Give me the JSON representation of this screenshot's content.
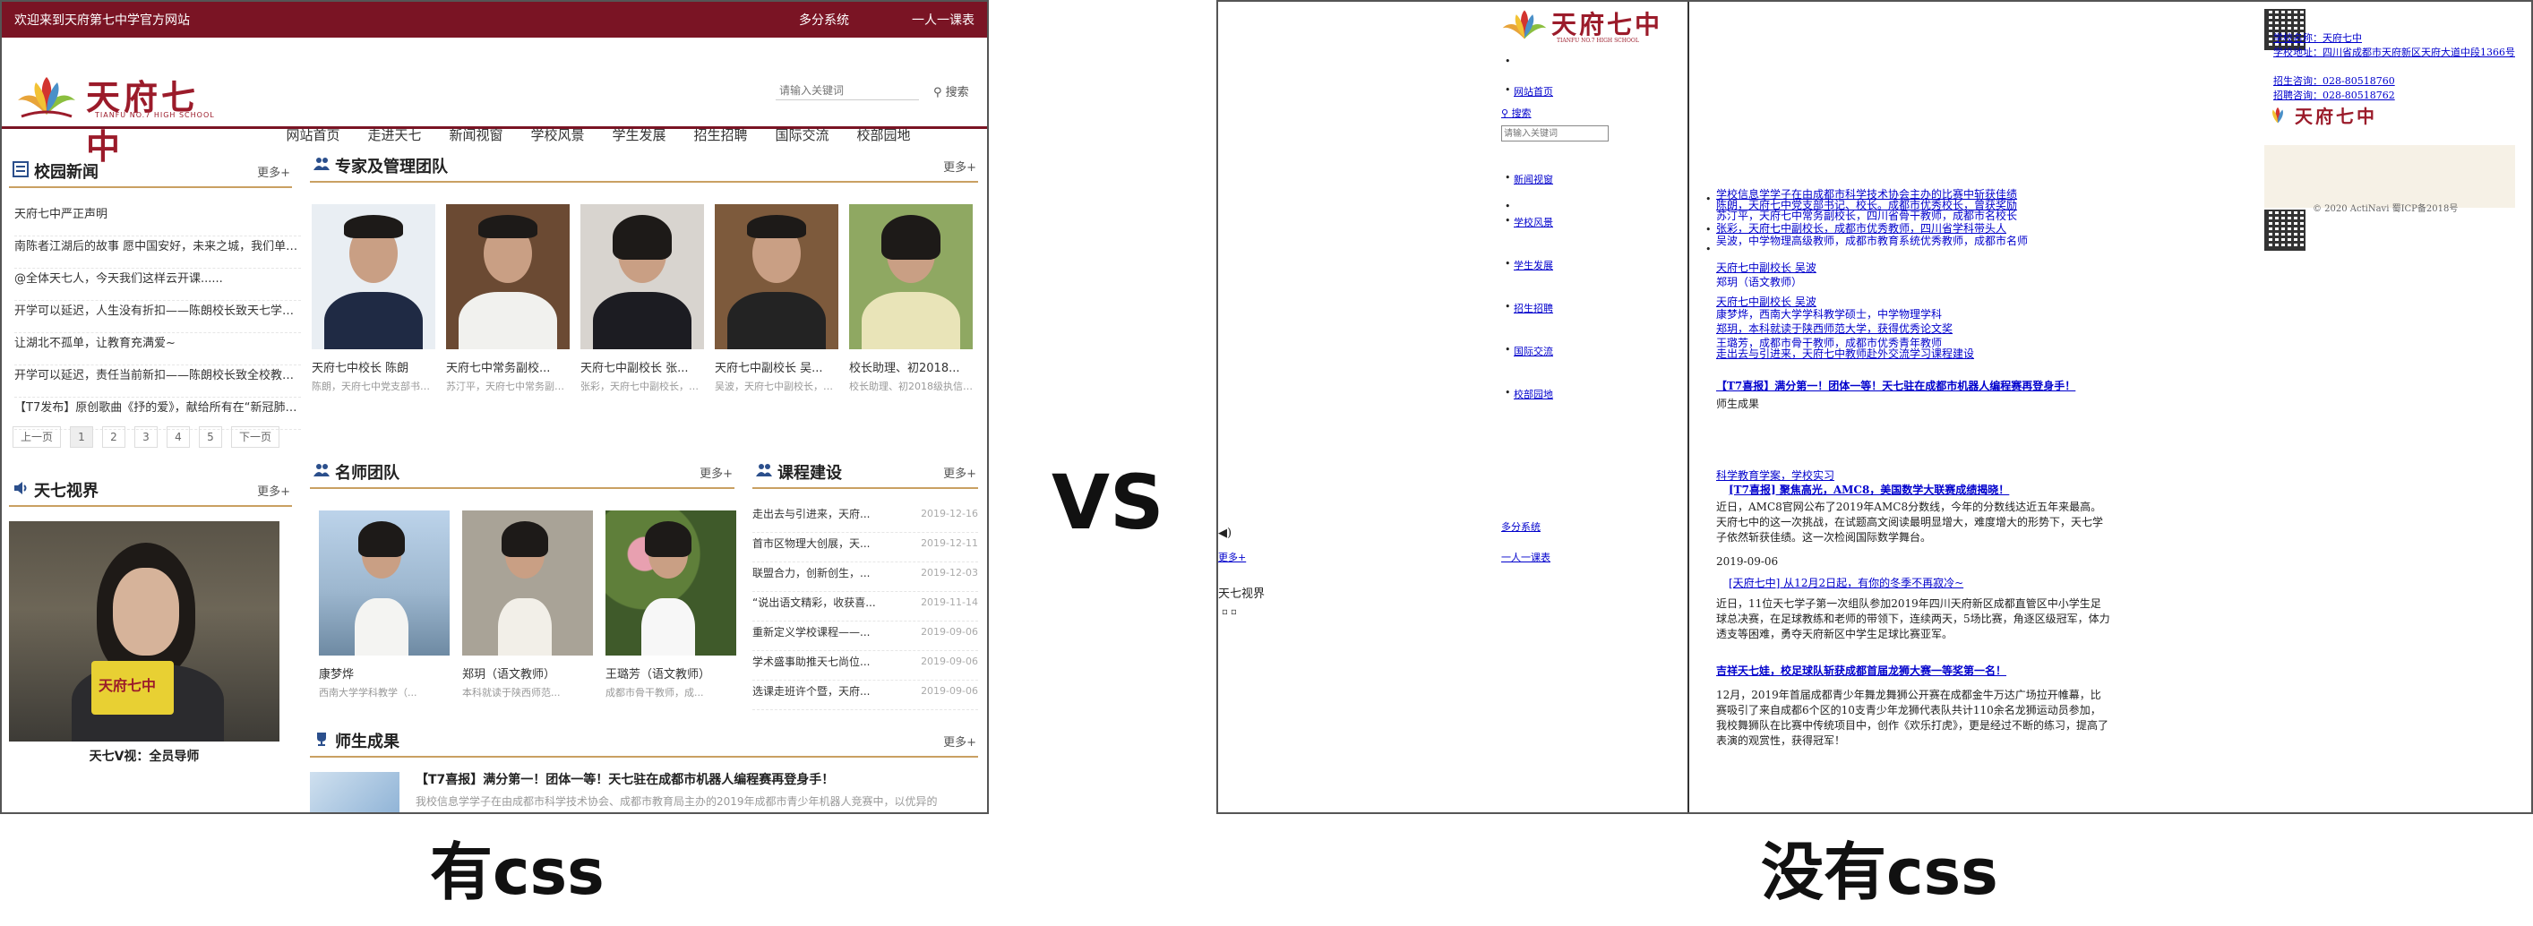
{
  "left": {
    "topbar": {
      "welcome": "欢迎来到天府第七中学官方网站",
      "link1": "多分系统",
      "link2": "一人一课表"
    },
    "logo": {
      "cn": "天府七中",
      "en": "TIANFU NO.7 HIGH SCHOOL"
    },
    "search": {
      "placeholder": "请输入关键词",
      "button": "搜索"
    },
    "nav": [
      "网站首页",
      "走进天七",
      "新闻视窗",
      "学校风景",
      "学生发展",
      "招生招聘",
      "国际交流",
      "校部园地"
    ],
    "campus_news": {
      "title": "校园新闻",
      "more": "更多+",
      "items": [
        "天府七中严正声明",
        "南陈者江湖后的故事 愿中国安好，未来之城，我们单年...",
        "@全体天七人，今天我们这样云开课......",
        "开学可以延迟，人生没有折扣——陈朗校长致天七学子...",
        "让湖北不孤单，让教育充满爱~",
        "开学可以延迟，责任当前新扣——陈朗校长致全校教职...",
        "【T7发布】原创歌曲《抒的爱》，献给所有在“新冠肺炎..."
      ],
      "pager": {
        "prev": "上一页",
        "pages": [
          "1",
          "2",
          "3",
          "4",
          "5"
        ],
        "next": "下一页"
      }
    },
    "video": {
      "title": "天七视界",
      "more": "更多+",
      "mic_text": "天府七中",
      "caption": "天七V视：全员导师"
    },
    "experts": {
      "title": "专家及管理团队",
      "more": "更多+",
      "cards": [
        {
          "name": "天府七中校长 陈朗",
          "desc": "陈朗，天府七中党支部书记、校长。成..."
        },
        {
          "name": "天府七中常务副校...",
          "desc": "苏汀平，天府七中常务副校长，成都市..."
        },
        {
          "name": "天府七中副校长 张...",
          "desc": "张彩，天府七中副校长，原绵阳某知名..."
        },
        {
          "name": "天府七中副校长 吴...",
          "desc": "吴波，天府七中副校长，中学物理高级..."
        },
        {
          "name": "校长助理、初2018...",
          "desc": "校长助理、初2018级执信学部..."
        }
      ]
    },
    "teachers": {
      "title": "名师团队",
      "more": "更多+",
      "cards": [
        {
          "name": "康梦烨",
          "desc": "西南大学学科教学（..."
        },
        {
          "name": "郑玥（语文教师）",
          "desc": "本科就读于陕西师范..."
        },
        {
          "name": "王璐芳（语文教师）",
          "desc": "成都市骨干教师，成..."
        }
      ]
    },
    "courses": {
      "title": "课程建设",
      "more": "更多+",
      "items": [
        {
          "t": "走出去与引进来，天府...",
          "d": "2019-12-16"
        },
        {
          "t": "首市区物理大创展，天...",
          "d": "2019-12-11"
        },
        {
          "t": "联盟合力，创新创生，...",
          "d": "2019-12-03"
        },
        {
          "t": "“说出语文精彩，收获喜...",
          "d": "2019-11-14"
        },
        {
          "t": "重新定义学校课程——...",
          "d": "2019-09-06"
        },
        {
          "t": "学术盛事助推天七尚位...",
          "d": "2019-09-06"
        },
        {
          "t": "选课走班许个暨，天府...",
          "d": "2019-09-06"
        }
      ]
    },
    "achievements": {
      "title": "师生成果",
      "more": "更多+",
      "headline": "【T7喜报】满分第一！团体一等！天七驻在成都市机器人编程赛再登身手！",
      "desc": "我校信息学学子在由成都市科学技术协会、成都市教育局主办的2019年成都市青少年机器人竞赛中，以优异的"
    }
  },
  "vs_label": "VS",
  "caption_left": "有css",
  "caption_right": "没有css",
  "right": {
    "logo": {
      "cn": "天府七中",
      "en": "TIANFU NO.7 HIGH SCHOOL"
    },
    "sidebar_links": [
      "网站首页",
      "新闻视窗",
      "学校风景",
      "学生发展",
      "招生招聘",
      "国际交流",
      "校部园地"
    ],
    "search_label": "搜索",
    "search_placeholder": "请输入关键词",
    "link_duofen": "多分系统",
    "link_kebiao": "一人一课表",
    "more": "更多+",
    "video_title": "天七视界",
    "contact": [
      "学校名称：天府七中",
      "学校地址：四川省成都市天府新区天府大道中段1366号",
      "招生咨询：028-80518760",
      "招聘咨询：028-80518762"
    ],
    "copyright": "© 2020 ActiNavi  蜀ICP备2018号",
    "main": {
      "h1": "天府七中副校长 吴波",
      "h2": "郑玥（语文教师）",
      "h3": "师生成果",
      "h4": "【T7喜报】满分第一！团体一等！天七驻在成都市机器人编程赛再登身手！",
      "h5": "科学教育学案，学校实习",
      "h6": "[T7喜报] 聚焦高光，AMC8，美国数学大联赛成绩揭晓！",
      "d6": "近日，AMC8官网公布了2019年AMC8分数线，今年的分数线达近五年来最高。天府七中的这一次挑战，在试题高文阅读最明显增大，难度增大的形势下，天七学子依然斩获佳绩。这一次检阅国际数学舞台。",
      "date1": "2019-09-06",
      "h7": "[天府七中] 从12月2日起，有你的冬季不再寂冷~",
      "d7": "近日，11位天七学子第一次组队参加2019年四川天府新区成都直管区中小学生足球总决赛，在足球教练和老师的带领下，连续两天，5场比赛，角逐区级冠军，体力透支等困难，勇夺天府新区中学生足球比赛亚军。",
      "h8": "吉祥天七娃，校足球队斩获成都首届龙狮大赛一等奖第一名！",
      "d8": "12月，2019年首届成都青少年舞龙舞狮公开赛在成都金牛万达广场拉开帷幕，比赛吸引了来自成都6个区的10支青少年龙狮代表队共计110余名龙狮运动员参加，我校舞狮队在比赛中传统项目中，创作《欢乐打虎》，更是经过不断的练习，提高了表演的观赏性，获得冠军！",
      "overlap_lines": [
        "学校信息学学子在由成都市科学技术协会主办的比赛中斩获佳绩",
        "陈朗，天府七中党支部书记、校长。成都市优秀校长，曾获奖励",
        "苏汀平，天府七中常务副校长，四川省骨干教师，成都市名校长",
        "张彩，天府七中副校长，成都市优秀教师，四川省学科带头人",
        "吴波，中学物理高级教师，成都市教育系统优秀教师，成都市名师",
        "天府七中副校长 吴波",
        "康梦烨，西南大学学科教学硕士，中学物理学科",
        "郑玥，本科就读于陕西师范大学，获得优秀论文奖",
        "王璐芳，成都市骨干教师，成都市优秀青年教师",
        "走出去与引进来，天府七中教师赴外交流学习课程建设"
      ]
    }
  }
}
